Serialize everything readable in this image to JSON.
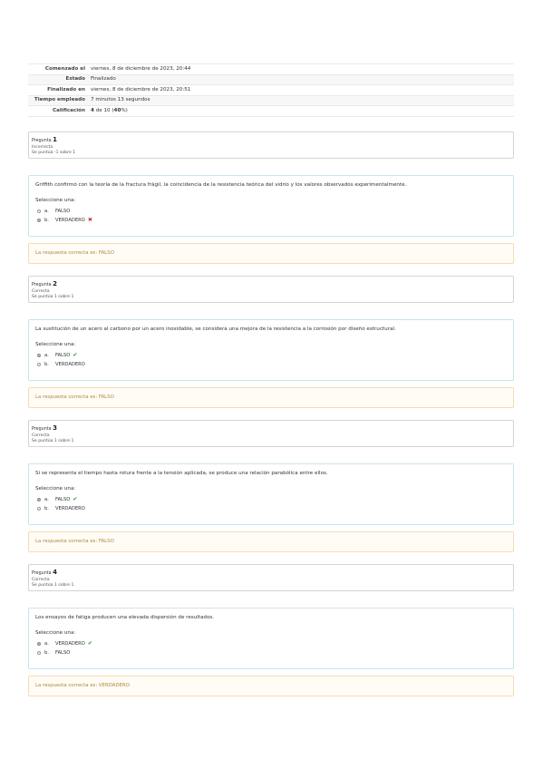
{
  "summary": [
    {
      "label": "Comenzado el",
      "value": "viernes, 8 de diciembre de 2023, 20:44"
    },
    {
      "label": "Estado",
      "value": "Finalizado"
    },
    {
      "label": "Finalizado en",
      "value": "viernes, 8 de diciembre de 2023, 20:51"
    },
    {
      "label": "Tiempo empleado",
      "value": "7 minutos 13 segundos"
    },
    {
      "label": "Calificación",
      "value_strong": "4",
      "value_mid": " de 10 (",
      "value_pct": "40",
      "value_end": "%)"
    }
  ],
  "questions": [
    {
      "prefix": "Pregunta",
      "number": "1",
      "status": "Incorrecta",
      "score": "Se puntúa -1 sobre 1",
      "text": "Griffith confirmó con la teoría de la fractura frágil, la coincidencia de la resistencia teórica del vidrio y los valores observados experimentalmente.",
      "prompt": "Seleccione una:",
      "options": [
        {
          "letter": "a.",
          "label": "FALSO",
          "selected": false,
          "mark": ""
        },
        {
          "letter": "b.",
          "label": "VERDADERO",
          "selected": true,
          "mark": "incorrect"
        }
      ],
      "feedback": "La respuesta correcta es: FALSO"
    },
    {
      "prefix": "Pregunta",
      "number": "2",
      "status": "Correcta",
      "score": "Se puntúa 1 sobre 1",
      "text": "La sustitución de un acero al carbono por un acero inoxidable, se considera una mejora de la resistencia a la corrosión por diseño estructural.",
      "prompt": "Seleccione una:",
      "options": [
        {
          "letter": "a.",
          "label": "FALSO",
          "selected": true,
          "mark": "correct"
        },
        {
          "letter": "b.",
          "label": "VERDADERO",
          "selected": false,
          "mark": ""
        }
      ],
      "feedback": "La respuesta correcta es: FALSO"
    },
    {
      "prefix": "Pregunta",
      "number": "3",
      "status": "Correcta",
      "score": "Se puntúa 1 sobre 1",
      "text": "Si se representa el tiempo hasta rotura frente a la tensión aplicada, se produce una relación parabólica entre ellos.",
      "prompt": "Seleccione una:",
      "options": [
        {
          "letter": "a.",
          "label": "FALSO",
          "selected": true,
          "mark": "correct"
        },
        {
          "letter": "b.",
          "label": "VERDADERO",
          "selected": false,
          "mark": ""
        }
      ],
      "feedback": "La respuesta correcta es: FALSO"
    },
    {
      "prefix": "Pregunta",
      "number": "4",
      "status": "Correcta",
      "score": "Se puntúa 1 sobre 1",
      "text": "Los ensayos de fatiga producen una elevada dispersión de resultados.",
      "prompt": "Seleccione una:",
      "options": [
        {
          "letter": "a.",
          "label": "VERDADERO",
          "selected": true,
          "mark": "correct"
        },
        {
          "letter": "b.",
          "label": "FALSO",
          "selected": false,
          "mark": ""
        }
      ],
      "feedback": "La respuesta correcta es: VERDADERO"
    }
  ],
  "icons": {
    "correct": "check-icon",
    "incorrect": "cross-icon"
  },
  "colors": {
    "correct": "#2e9a2e",
    "incorrect": "#c9302c",
    "feedback_text": "#b38838"
  }
}
